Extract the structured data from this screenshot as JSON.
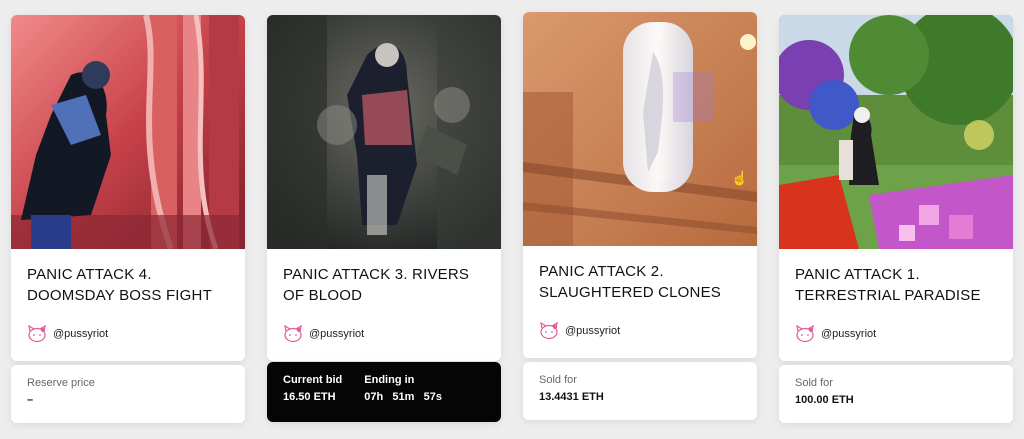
{
  "cards": [
    {
      "title": "PANIC ATTACK 4. DOOMSDAY BOSS FIGHT",
      "author": "@pussyriot",
      "footer": {
        "label": "Reserve price",
        "value": "–"
      }
    },
    {
      "title": "PANIC ATTACK 3. RIVERS OF BLOOD",
      "author": "@pussyriot",
      "footer": {
        "bid_label": "Current bid",
        "bid_value": "16.50 ETH",
        "end_label": "Ending in",
        "end_h": "07h",
        "end_m": "51m",
        "end_s": "57s"
      }
    },
    {
      "title": "PANIC ATTACK 2. SLAUGHTERED CLONES",
      "author": "@pussyriot",
      "footer": {
        "label": "Sold for",
        "value": "13.4431 ETH"
      }
    },
    {
      "title": "PANIC ATTACK 1. TERRESTRIAL PARADISE",
      "author": "@pussyriot",
      "footer": {
        "label": "Sold for",
        "value": "100.00 ETH"
      }
    }
  ],
  "icons": {
    "avatar": "hello-kitty-avatar-icon",
    "cursor": "mouse-cursor-icon"
  },
  "colors": {
    "active_footer": "#050505",
    "avatar_pink": "#e55a9a"
  }
}
